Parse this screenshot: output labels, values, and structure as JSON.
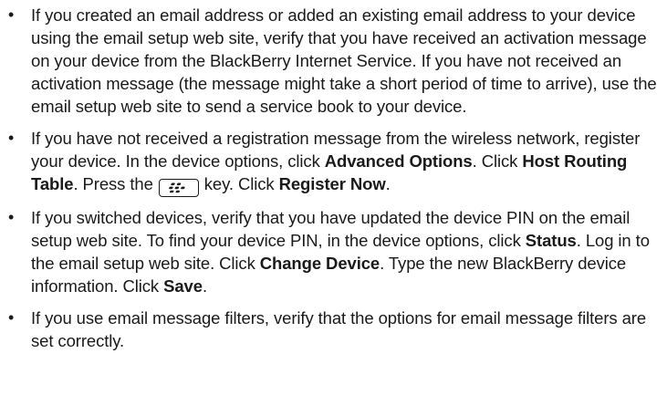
{
  "bullet_char": "•",
  "items": [
    {
      "text": "If you created an email address or added an existing email address to your device using the email setup web site, verify that you have received an activation message on your device from the BlackBerry Internet Service. If you have not received an activation message (the message might take a short period of time to arrive), use the email setup web site to send a service book to your device."
    },
    {
      "t1": "If you have not received a registration message from the wireless network, register your device. In the device options, click ",
      "b1": "Advanced Options",
      "t2": ". Click ",
      "b2": "Host Routing Table",
      "t3": ". Press the",
      "key_icon": "blackberry-menu-key-icon",
      "t4": "key. Click ",
      "b3": "Register Now",
      "t5": "."
    },
    {
      "t1": "If you switched devices, verify that you have updated the device PIN on the email setup web site. To find your device PIN, in the device options, click ",
      "b1": "Status",
      "t2": ". Log in to the email setup web site. Click ",
      "b2": "Change Device",
      "t3": ". Type the new BlackBerry device information. Click ",
      "b3": "Save",
      "t4": "."
    },
    {
      "text": "If you use email message filters, verify that the options for email message filters are set correctly."
    }
  ]
}
